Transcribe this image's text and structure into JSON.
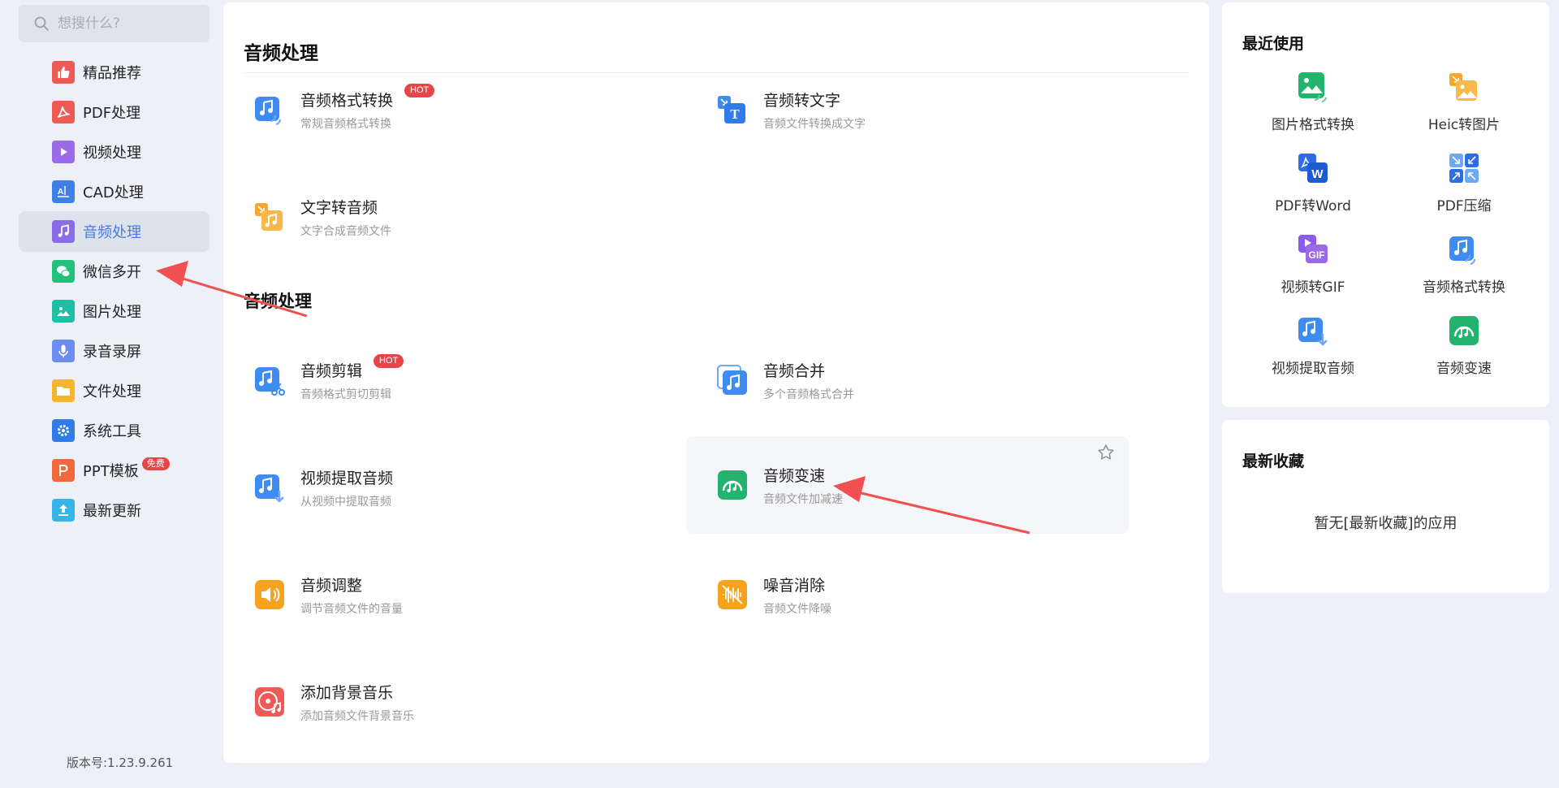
{
  "search": {
    "placeholder": "想搜什么?"
  },
  "sidebar": {
    "items": [
      {
        "label": "精品推荐",
        "icon": "thumbs-up-icon",
        "color": "#ee5a55"
      },
      {
        "label": "PDF处理",
        "icon": "pdf-icon",
        "color": "#ee5a55"
      },
      {
        "label": "视频处理",
        "icon": "play-icon",
        "color": "#9a6ae8"
      },
      {
        "label": "CAD处理",
        "icon": "cad-icon",
        "color": "#3f7fe8"
      },
      {
        "label": "音频处理",
        "icon": "music-note-icon",
        "color": "#8a6ce8"
      },
      {
        "label": "微信多开",
        "icon": "wechat-icon",
        "color": "#22c07a"
      },
      {
        "label": "图片处理",
        "icon": "image-icon",
        "color": "#1fbfa5"
      },
      {
        "label": "录音录屏",
        "icon": "microphone-icon",
        "color": "#6b8cf0"
      },
      {
        "label": "文件处理",
        "icon": "folder-icon",
        "color": "#f7b52c"
      },
      {
        "label": "系统工具",
        "icon": "gear-icon",
        "color": "#2f7ce8"
      },
      {
        "label": "PPT模板",
        "icon": "ppt-icon",
        "color": "#f06a3c",
        "badge": "免费"
      },
      {
        "label": "最新更新",
        "icon": "upload-icon",
        "color": "#35b5e8"
      }
    ],
    "active_index": 4
  },
  "version": "版本号:1.23.9.261",
  "main": {
    "section1_title": "音频处理",
    "section2_title": "音频处理",
    "tools": [
      {
        "name": "音频格式转换",
        "desc": "常规音频格式转换",
        "badge": "HOT",
        "icon": "audio-convert-icon"
      },
      {
        "name": "音频转文字",
        "desc": "音频文件转换成文字",
        "icon": "audio-to-text-icon"
      },
      {
        "name": "文字转音频",
        "desc": "文字合成音频文件",
        "icon": "text-to-audio-icon"
      },
      {
        "name": "音频剪辑",
        "desc": "音频格式剪切剪辑",
        "badge": "HOT",
        "icon": "audio-cut-icon"
      },
      {
        "name": "音频合并",
        "desc": "多个音频格式合并",
        "icon": "audio-merge-icon"
      },
      {
        "name": "视频提取音频",
        "desc": "从视频中提取音频",
        "icon": "video-extract-audio-icon"
      },
      {
        "name": "音频变速",
        "desc": "音频文件加减速",
        "icon": "audio-speed-icon"
      },
      {
        "name": "音频调整",
        "desc": "调节音频文件的音量",
        "icon": "volume-icon"
      },
      {
        "name": "噪音消除",
        "desc": "音频文件降噪",
        "icon": "noise-reduction-icon"
      },
      {
        "name": "添加背景音乐",
        "desc": "添加音频文件背景音乐",
        "icon": "background-music-icon"
      }
    ]
  },
  "recent": {
    "title": "最近使用",
    "items": [
      {
        "label": "图片格式转换",
        "icon": "image-convert-icon"
      },
      {
        "label": "Heic转图片",
        "icon": "heic-icon"
      },
      {
        "label": "PDF转Word",
        "icon": "pdf-to-word-icon"
      },
      {
        "label": "PDF压缩",
        "icon": "pdf-compress-icon"
      },
      {
        "label": "视频转GIF",
        "icon": "video-to-gif-icon"
      },
      {
        "label": "音频格式转换",
        "icon": "audio-convert-icon"
      },
      {
        "label": "视频提取音频",
        "icon": "video-extract-audio-icon"
      },
      {
        "label": "音频变速",
        "icon": "audio-speed-icon"
      }
    ]
  },
  "favorites": {
    "title": "最新收藏",
    "empty_text": "暂无[最新收藏]的应用"
  }
}
